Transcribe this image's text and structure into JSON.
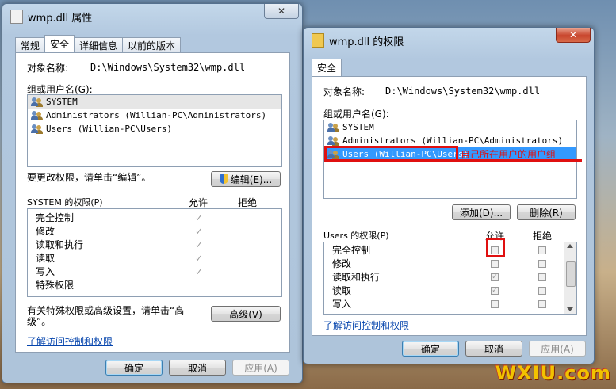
{
  "left_window": {
    "title": "wmp.dll 属性",
    "close_glyph": "✕",
    "tabs": [
      "常规",
      "安全",
      "详细信息",
      "以前的版本"
    ],
    "active_tab": "安全",
    "object_label": "对象名称:",
    "object_value": "D:\\Windows\\System32\\wmp.dll",
    "group_label": "组或用户名(G):",
    "users": [
      "SYSTEM",
      "Administrators (Willian-PC\\Administrators)",
      "Users (Willian-PC\\Users)"
    ],
    "edit_hint": "要更改权限，请单击“编辑”。",
    "edit_button": "编辑(E)...",
    "perm_header": "SYSTEM 的权限(P)",
    "allow_header": "允许",
    "deny_header": "拒绝",
    "permissions": [
      {
        "name": "完全控制",
        "allow": true
      },
      {
        "name": "修改",
        "allow": true
      },
      {
        "name": "读取和执行",
        "allow": true
      },
      {
        "name": "读取",
        "allow": true
      },
      {
        "name": "写入",
        "allow": true
      },
      {
        "name": "特殊权限",
        "allow": false
      }
    ],
    "advanced_hint_line1": "有关特殊权限或高级设置，请单击“高",
    "advanced_hint_line2": "级”。",
    "advanced_button": "高级(V)",
    "learn_link": "了解访问控制和权限",
    "ok": "确定",
    "cancel": "取消",
    "apply": "应用(A)"
  },
  "right_window": {
    "title": "wmp.dll 的权限",
    "close_glyph": "✕",
    "tab": "安全",
    "object_label": "对象名称:",
    "object_value": "D:\\Windows\\System32\\wmp.dll",
    "group_label": "组或用户名(G):",
    "users": [
      "SYSTEM",
      "Administrators (Willian-PC\\Administrators)",
      "Users (Willian-PC\\Users)"
    ],
    "selected_user_index": 2,
    "annotation": "自己所在用户的用户组",
    "add_button": "添加(D)...",
    "remove_button": "删除(R)",
    "perm_header": "Users 的权限(P)",
    "allow_header": "允许",
    "deny_header": "拒绝",
    "permissions": [
      {
        "name": "完全控制",
        "allow": false
      },
      {
        "name": "修改",
        "allow": false
      },
      {
        "name": "读取和执行",
        "allow": true
      },
      {
        "name": "读取",
        "allow": true
      },
      {
        "name": "写入",
        "allow": false
      }
    ],
    "learn_link": "了解访问控制和权限",
    "ok": "确定",
    "cancel": "取消",
    "apply": "应用(A)"
  },
  "watermark": "WXIU.com",
  "colors": {
    "highlight": "#3399ff",
    "annotation": "#e01010",
    "link": "#0645ad"
  }
}
